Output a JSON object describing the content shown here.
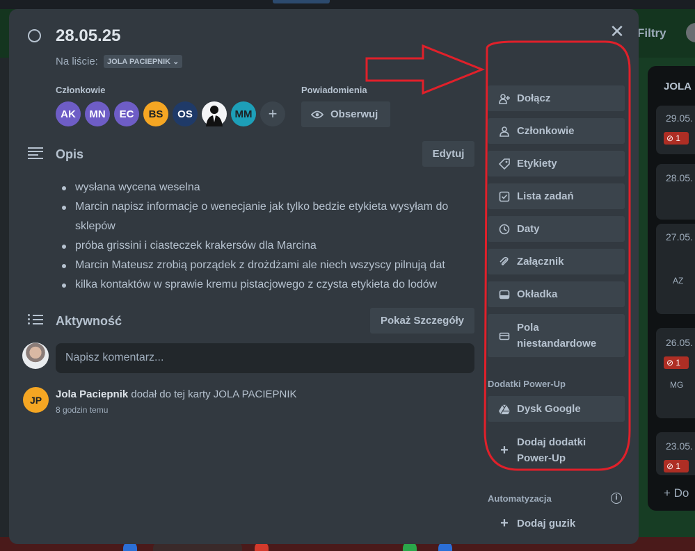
{
  "background": {
    "filters_label": "Filtry",
    "list_title": "JOLA",
    "cards": [
      {
        "date": "29.05.",
        "badge": "1"
      },
      {
        "date": "28.05."
      },
      {
        "date": "27.05.",
        "member": "AZ"
      },
      {
        "date": "26.05.",
        "badge": "1",
        "member": "MG"
      },
      {
        "date": "23.05.",
        "badge": "1"
      }
    ],
    "add_label": "Do"
  },
  "card": {
    "title": "28.05.25",
    "list_prefix": "Na liście:",
    "list_name": "JOLA PACIEPNIK",
    "members_label": "Członkowie",
    "members": [
      {
        "initials": "AK",
        "color": "#6e5dc6"
      },
      {
        "initials": "MN",
        "color": "#6e5dc6"
      },
      {
        "initials": "EC",
        "color": "#6e5dc6"
      },
      {
        "initials": "BS",
        "color": "#f5a623"
      },
      {
        "initials": "OS",
        "color": "#1f3a68"
      },
      {
        "initials": "",
        "color": "#f4f5f7",
        "photo": true
      },
      {
        "initials": "MM",
        "color": "#1d9fb8"
      }
    ],
    "notifications_label": "Powiadomienia",
    "watch_label": "Obserwuj",
    "description_title": "Opis",
    "edit_label": "Edytuj",
    "description_items": [
      "wysłana wycena weselna",
      "Marcin napisz informacje o wenecjanie jak tylko bedzie etykieta wysyłam  do sklepów",
      "próba grissini i ciasteczek krakersów dla Marcina",
      "Marcin Mateusz zrobią porządek z drożdżami ale niech wszyscy pilnują dat",
      "kilka kontaktów w sprawie kremu pistacjowego z czysta etykieta do lodów"
    ],
    "activity_title": "Aktywność",
    "details_label": "Pokaż Szczegóły",
    "comment_placeholder": "Napisz komentarz...",
    "activity": {
      "initials": "JP",
      "author": "Jola Paciepnik",
      "text": " dodał do tej karty JOLA PACIEPNIK",
      "time": "8 godzin temu"
    }
  },
  "sidebar": {
    "buttons": [
      {
        "label": "Dołącz",
        "icon": "join-icon"
      },
      {
        "label": "Członkowie",
        "icon": "person-icon"
      },
      {
        "label": "Etykiety",
        "icon": "tag-icon"
      },
      {
        "label": "Lista zadań",
        "icon": "checkbox-icon"
      },
      {
        "label": "Daty",
        "icon": "clock-icon"
      },
      {
        "label": "Załącznik",
        "icon": "paperclip-icon"
      },
      {
        "label": "Okładka",
        "icon": "cover-icon"
      },
      {
        "label": "Pola niestandardowe",
        "icon": "custom-fields-icon"
      }
    ],
    "powerups_label": "Dodatki Power-Up",
    "google_drive_label": "Dysk Google",
    "add_powerups_label": "Dodaj dodatki Power-Up",
    "automation_label": "Automatyzacja",
    "add_button_label": "Dodaj guzik"
  },
  "annotation_color": "#e0202a"
}
